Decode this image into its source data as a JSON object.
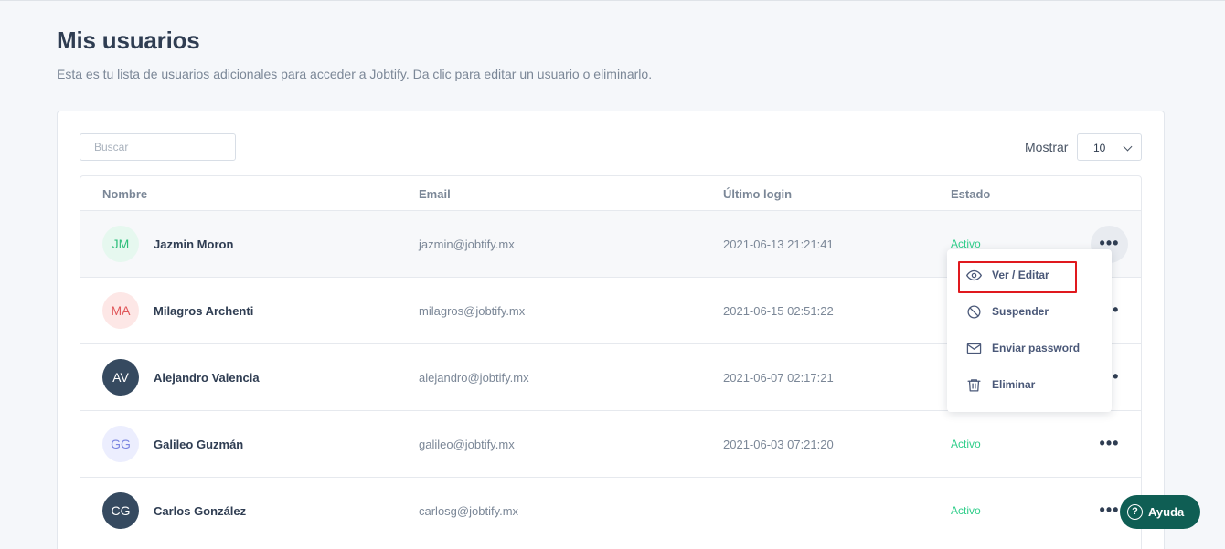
{
  "header": {
    "title": "Mis usuarios",
    "subtitle": "Esta es tu lista de usuarios adicionales para acceder a Jobtify. Da clic para editar un usuario o eliminarlo."
  },
  "toolbar": {
    "search_placeholder": "Buscar",
    "show_label": "Mostrar",
    "show_value": "10"
  },
  "table": {
    "columns": [
      "Nombre",
      "Email",
      "Último login",
      "Estado"
    ],
    "rows": [
      {
        "initials": "JM",
        "name": "Jazmin Moron",
        "email": "jazmin@jobtify.mx",
        "last_login": "2021-06-13 21:21:41",
        "status": "Activo",
        "avatar_bg": "#e6f8ef",
        "avatar_fg": "#2fbf7c"
      },
      {
        "initials": "MA",
        "name": "Milagros Archenti",
        "email": "milagros@jobtify.mx",
        "last_login": "2021-06-15 02:51:22",
        "status": "",
        "avatar_bg": "#fde7e6",
        "avatar_fg": "#e0575a"
      },
      {
        "initials": "AV",
        "name": "Alejandro Valencia",
        "email": "alejandro@jobtify.mx",
        "last_login": "2021-06-07 02:17:21",
        "status": "",
        "avatar_bg": "#364a60",
        "avatar_fg": "#ffffff"
      },
      {
        "initials": "GG",
        "name": "Galileo Guzmán",
        "email": "galileo@jobtify.mx",
        "last_login": "2021-06-03 07:21:20",
        "status": "Activo",
        "avatar_bg": "#eceefe",
        "avatar_fg": "#7b86e0"
      },
      {
        "initials": "CG",
        "name": "Carlos González",
        "email": "carlosg@jobtify.mx",
        "last_login": "",
        "status": "Activo",
        "avatar_bg": "#364a60",
        "avatar_fg": "#ffffff"
      }
    ]
  },
  "row_menu": {
    "items": [
      {
        "label": "Ver / Editar",
        "icon": "eye-icon"
      },
      {
        "label": "Suspender",
        "icon": "ban-icon"
      },
      {
        "label": "Enviar password",
        "icon": "mail-icon"
      },
      {
        "label": "Eliminar",
        "icon": "trash-icon"
      }
    ]
  },
  "help": {
    "label": "Ayuda",
    "icon": "question-icon"
  },
  "colors": {
    "accent": "#0f5e54",
    "status_active": "#2fce8a",
    "highlight": "#e0191e"
  }
}
